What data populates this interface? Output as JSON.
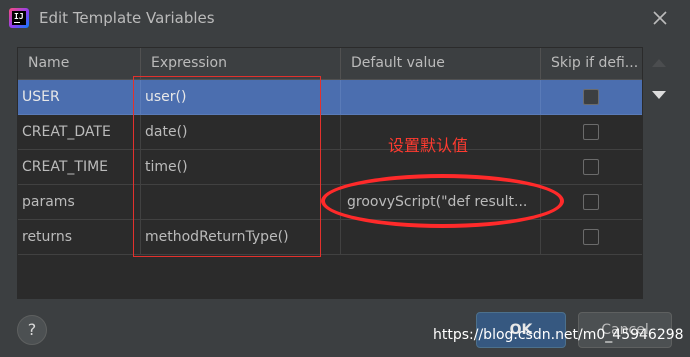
{
  "window": {
    "title": "Edit Template Variables",
    "app_icon_letters": "IJ"
  },
  "table": {
    "columns": [
      "Name",
      "Expression",
      "Default value",
      "Skip if defi..."
    ],
    "rows": [
      {
        "name": "USER",
        "expression": "user()",
        "default_value": "",
        "skip": false,
        "selected": true
      },
      {
        "name": "CREAT_DATE",
        "expression": "date()",
        "default_value": "",
        "skip": false,
        "selected": false
      },
      {
        "name": "CREAT_TIME",
        "expression": "time()",
        "default_value": "",
        "skip": false,
        "selected": false
      },
      {
        "name": "params",
        "expression": "",
        "default_value": "groovyScript(\"def result...",
        "skip": false,
        "selected": false
      },
      {
        "name": "returns",
        "expression": "methodReturnType()",
        "default_value": "",
        "skip": false,
        "selected": false
      }
    ]
  },
  "annotation": {
    "text": "设置默认值",
    "color": "#ff3b30"
  },
  "buttons": {
    "help": "?",
    "ok": "OK",
    "cancel": "Cancel"
  },
  "watermark": "https://blog.csdn.net/m0_45946298",
  "colors": {
    "background": "#3c3f41",
    "table_bg": "#2b2b2b",
    "selection": "#4b6eaf",
    "ok_button": "#365880",
    "annotation_red": "#ff2a2a"
  }
}
